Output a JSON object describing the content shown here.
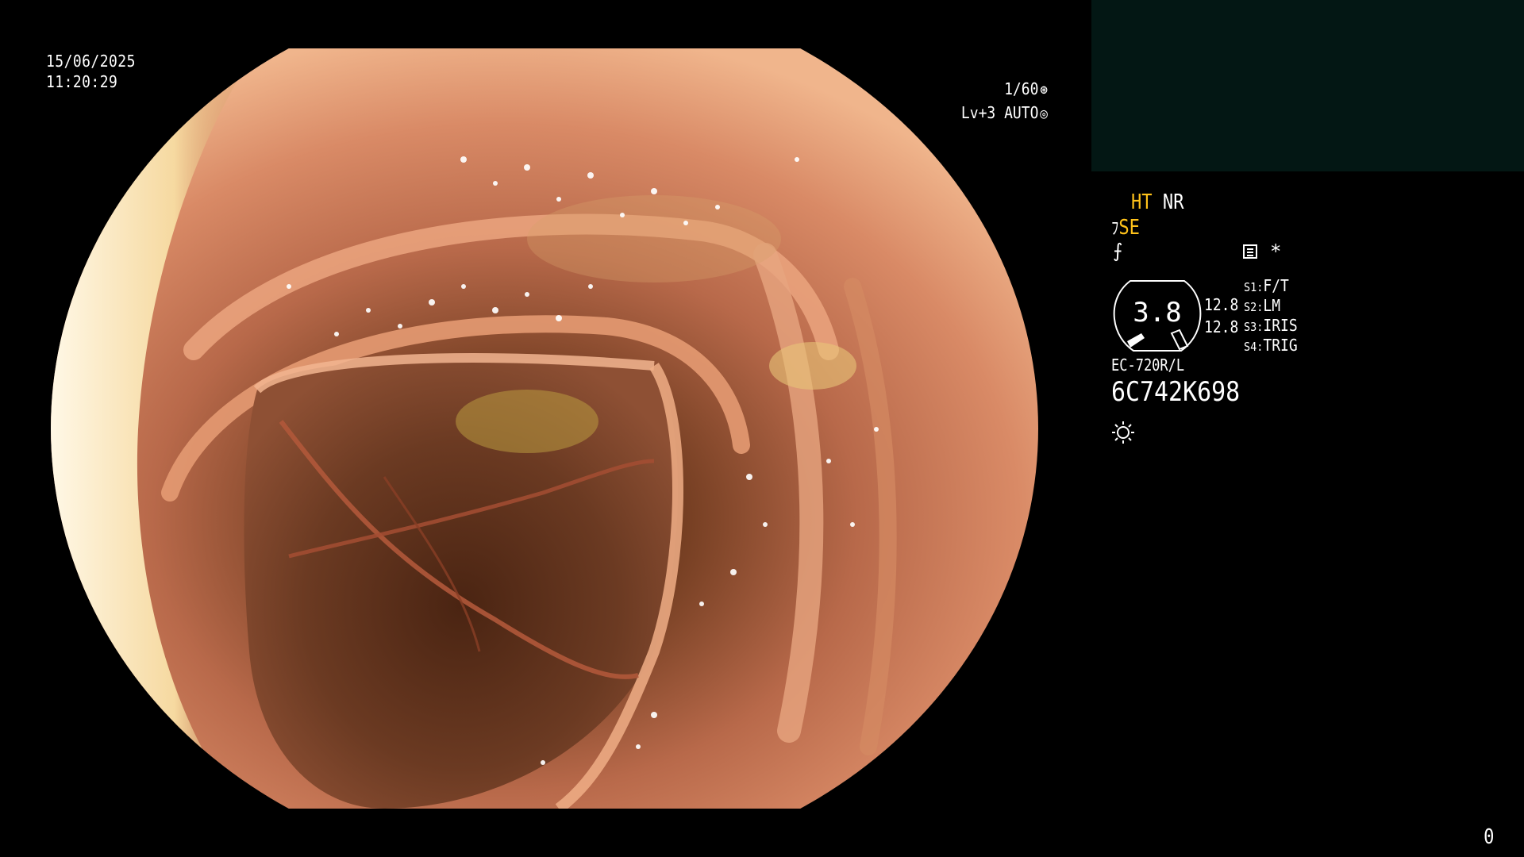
{
  "overlay": {
    "date": "15/06/2025",
    "time": "11:20:29"
  },
  "exposure": {
    "shutter": "1/60",
    "shutter_icon": "aperture-icon",
    "level": "Lv+3 AUTO",
    "level_icon": "iris-icon"
  },
  "modes": {
    "ht": "HT",
    "nr": "NR",
    "se": "SE",
    "asterisk": "*"
  },
  "gauge": {
    "value": "3.8",
    "side_top": "12.8",
    "side_bottom": "12.8"
  },
  "switches": [
    {
      "key": "S1",
      "label": "F/T"
    },
    {
      "key": "S2",
      "label": "LM"
    },
    {
      "key": "S3",
      "label": "IRIS"
    },
    {
      "key": "S4",
      "label": "TRIG"
    }
  ],
  "scope": {
    "model": "EC-720R/L",
    "serial": "6C742K698"
  },
  "counter": "0",
  "colors": {
    "accent_yellow": "#ffc21a",
    "panel_teal": "#031714"
  }
}
